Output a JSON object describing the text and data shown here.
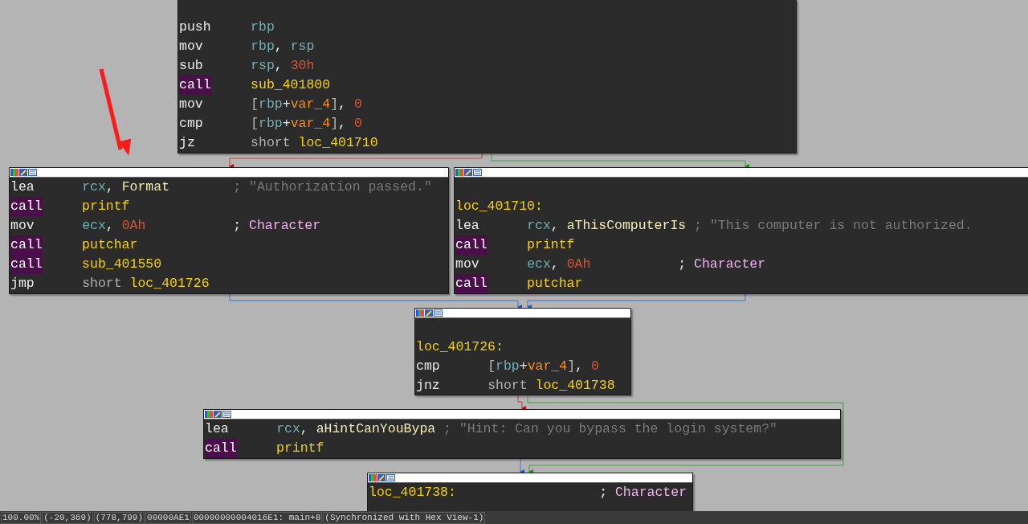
{
  "blocks": [
    {
      "lines": [
        {
          "kind": "insn",
          "mnemonic": "push",
          "operands": [
            {
              "t": "rbp",
              "kind": "reg"
            }
          ]
        },
        {
          "kind": "insn",
          "mnemonic": "mov",
          "operands": [
            {
              "t": "rbp",
              "kind": "reg"
            },
            {
              "t": ", ",
              "kind": "punct"
            },
            {
              "t": "rsp",
              "kind": "reg"
            }
          ]
        },
        {
          "kind": "insn",
          "mnemonic": "sub",
          "operands": [
            {
              "t": "rsp",
              "kind": "reg"
            },
            {
              "t": ", ",
              "kind": "punct"
            },
            {
              "t": "30h",
              "kind": "num"
            }
          ]
        },
        {
          "kind": "call",
          "mnemonic": "call",
          "operands": [
            {
              "t": "sub_401800",
              "kind": "sym"
            }
          ]
        },
        {
          "kind": "insn",
          "mnemonic": "mov",
          "operands": [
            {
              "t": "[",
              "kind": "bracket"
            },
            {
              "t": "rbp",
              "kind": "reg"
            },
            {
              "t": "+",
              "kind": "punct"
            },
            {
              "t": "var_4",
              "kind": "var"
            },
            {
              "t": "]",
              "kind": "bracket"
            },
            {
              "t": ", ",
              "kind": "punct"
            },
            {
              "t": "0",
              "kind": "num"
            }
          ]
        },
        {
          "kind": "insn",
          "mnemonic": "cmp",
          "operands": [
            {
              "t": "[",
              "kind": "bracket"
            },
            {
              "t": "rbp",
              "kind": "reg"
            },
            {
              "t": "+",
              "kind": "punct"
            },
            {
              "t": "var_4",
              "kind": "var"
            },
            {
              "t": "]",
              "kind": "bracket"
            },
            {
              "t": ", ",
              "kind": "punct"
            },
            {
              "t": "0",
              "kind": "num"
            }
          ]
        },
        {
          "kind": "insn",
          "mnemonic": "jz",
          "operands": [
            {
              "t": "short ",
              "kind": "kw"
            },
            {
              "t": "loc_401710",
              "kind": "sym"
            }
          ]
        }
      ]
    },
    {
      "lines": [
        {
          "kind": "insn",
          "mnemonic": "lea",
          "operands": [
            {
              "t": "rcx",
              "kind": "reg"
            },
            {
              "t": ", ",
              "kind": "punct"
            },
            {
              "t": "Format",
              "kind": "data"
            }
          ],
          "comment": [
            {
              "t": "; \"Authorization passed.\"",
              "kind": "str"
            }
          ]
        },
        {
          "kind": "call",
          "mnemonic": "call",
          "operands": [
            {
              "t": "printf",
              "kind": "sym"
            }
          ]
        },
        {
          "kind": "insn",
          "mnemonic": "mov",
          "operands": [
            {
              "t": "ecx",
              "kind": "reg"
            },
            {
              "t": ", ",
              "kind": "punct"
            },
            {
              "t": "0Ah",
              "kind": "num"
            }
          ],
          "comment": [
            {
              "t": "; ",
              "kind": "punct"
            },
            {
              "t": "Character",
              "kind": "arg"
            }
          ]
        },
        {
          "kind": "call",
          "mnemonic": "call",
          "operands": [
            {
              "t": "putchar",
              "kind": "sym"
            }
          ]
        },
        {
          "kind": "call",
          "mnemonic": "call",
          "operands": [
            {
              "t": "sub_401550",
              "kind": "sym"
            }
          ]
        },
        {
          "kind": "insn",
          "mnemonic": "jmp",
          "operands": [
            {
              "t": "short ",
              "kind": "kw"
            },
            {
              "t": "loc_401726",
              "kind": "sym"
            }
          ]
        }
      ]
    },
    {
      "lines": [
        {
          "kind": "blank"
        },
        {
          "kind": "label",
          "label": "loc_401710:"
        },
        {
          "kind": "insn",
          "mnemonic": "lea",
          "operands": [
            {
              "t": "rcx",
              "kind": "reg"
            },
            {
              "t": ", ",
              "kind": "punct"
            },
            {
              "t": "aThisComputerIs",
              "kind": "data"
            }
          ],
          "comment": [
            {
              "t": "; \"This computer is not authorized.",
              "kind": "str"
            }
          ]
        },
        {
          "kind": "call",
          "mnemonic": "call",
          "operands": [
            {
              "t": "printf",
              "kind": "sym"
            }
          ]
        },
        {
          "kind": "insn",
          "mnemonic": "mov",
          "operands": [
            {
              "t": "ecx",
              "kind": "reg"
            },
            {
              "t": ", ",
              "kind": "punct"
            },
            {
              "t": "0Ah",
              "kind": "num"
            }
          ],
          "comment": [
            {
              "t": "; ",
              "kind": "punct"
            },
            {
              "t": "Character",
              "kind": "arg"
            }
          ]
        },
        {
          "kind": "call",
          "mnemonic": "call",
          "operands": [
            {
              "t": "putchar",
              "kind": "sym"
            }
          ]
        }
      ]
    },
    {
      "lines": [
        {
          "kind": "blank"
        },
        {
          "kind": "label",
          "label": "loc_401726:"
        },
        {
          "kind": "insn",
          "mnemonic": "cmp",
          "operands": [
            {
              "t": "[",
              "kind": "bracket"
            },
            {
              "t": "rbp",
              "kind": "reg"
            },
            {
              "t": "+",
              "kind": "punct"
            },
            {
              "t": "var_4",
              "kind": "var"
            },
            {
              "t": "]",
              "kind": "bracket"
            },
            {
              "t": ", ",
              "kind": "punct"
            },
            {
              "t": "0",
              "kind": "num"
            }
          ]
        },
        {
          "kind": "insn",
          "mnemonic": "jnz",
          "operands": [
            {
              "t": "short ",
              "kind": "kw"
            },
            {
              "t": "loc_401738",
              "kind": "sym"
            }
          ]
        }
      ]
    },
    {
      "lines": [
        {
          "kind": "insn",
          "mnemonic": "lea",
          "operands": [
            {
              "t": "rcx",
              "kind": "reg"
            },
            {
              "t": ", ",
              "kind": "punct"
            },
            {
              "t": "aHintCanYouBypa",
              "kind": "data"
            }
          ],
          "comment": [
            {
              "t": "; \"Hint: Can you bypass the login system?\"",
              "kind": "str"
            }
          ]
        },
        {
          "kind": "call",
          "mnemonic": "call",
          "operands": [
            {
              "t": "printf",
              "kind": "sym"
            }
          ]
        }
      ]
    },
    {
      "lines": [
        {
          "kind": "label",
          "label": "loc_401738:",
          "comment": [
            {
              "t": "; ",
              "kind": "punct"
            },
            {
              "t": "Character",
              "kind": "arg"
            }
          ]
        }
      ]
    }
  ],
  "status_bar": [
    "100.00%",
    "(-20,369)",
    "(778,799)",
    "00000AE1",
    "00000000004016E1: main+8",
    "(Synchronized with Hex View-1)"
  ]
}
